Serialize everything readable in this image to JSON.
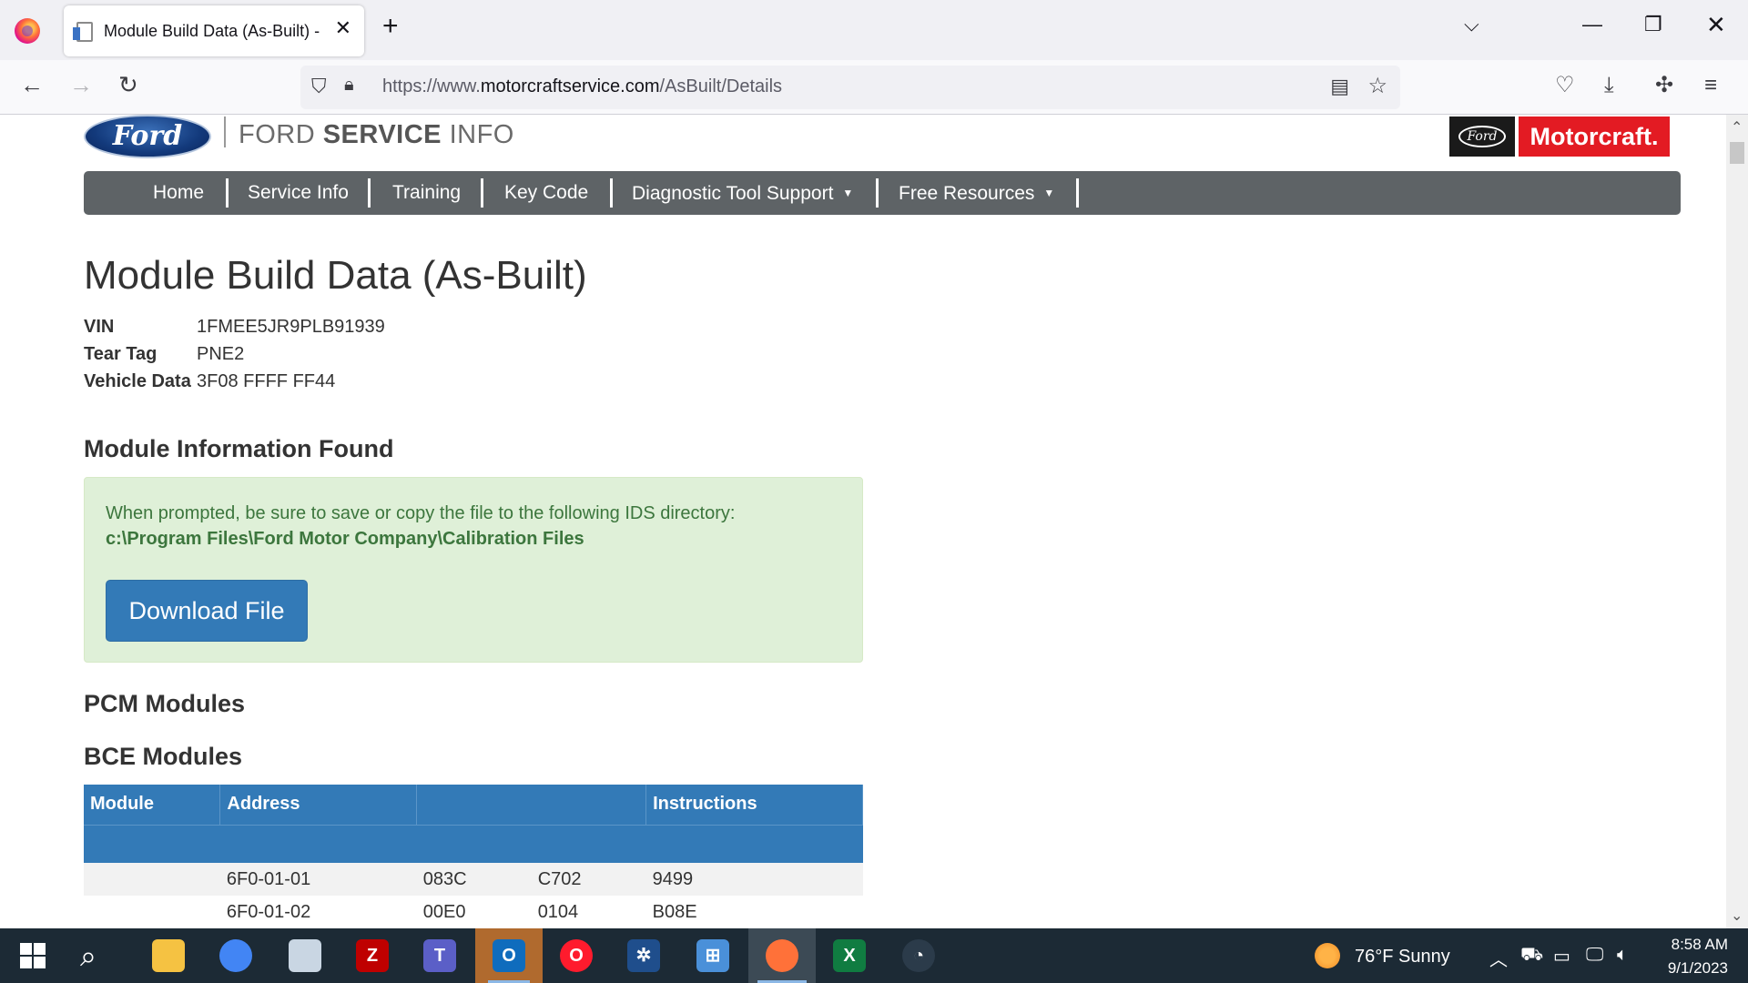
{
  "browser": {
    "tab_title": "Module Build Data (As-Built) - Ford",
    "url_prefix": "https://www.",
    "url_host": "motorcraftservice.com",
    "url_path": "/AsBuilt/Details"
  },
  "header": {
    "ford_oval_text": "Ford",
    "brand_light_1": "FORD ",
    "brand_bold": "SERVICE",
    "brand_light_2": " INFO",
    "motorcraft_ford_text": "Ford",
    "motorcraft_label": "Motorcraft."
  },
  "nav": {
    "items": [
      "Home",
      "Service Info",
      "Training",
      "Key Code",
      "Diagnostic Tool Support",
      "Free Resources"
    ]
  },
  "page": {
    "title": "Module Build Data (As-Built)",
    "vehicle_info": [
      {
        "label": "VIN",
        "value": "1FMEE5JR9PLB91939"
      },
      {
        "label": "Tear Tag",
        "value": "PNE2"
      },
      {
        "label": "Vehicle Data",
        "value": "3F08 FFFF FF44"
      }
    ],
    "module_info_heading": "Module Information Found",
    "alert_text": "When prompted, be sure to save or copy the file to the following IDS directory:",
    "alert_path": "c:\\Program Files\\Ford Motor Company\\Calibration Files",
    "download_label": "Download File",
    "pcm_heading": "PCM Modules",
    "bce_heading": "BCE Modules",
    "table": {
      "headers": [
        "Module",
        "Address",
        "",
        "Instructions"
      ],
      "rows": [
        [
          "",
          "6F0-01-01",
          "083C",
          "C702",
          "9499"
        ],
        [
          "",
          "6F0-01-02",
          "00E0",
          "0104",
          "B08E"
        ]
      ]
    }
  },
  "taskbar": {
    "weather": "76°F  Sunny",
    "time": "8:58 AM",
    "date": "9/1/2023",
    "apps": [
      {
        "name": "file-explorer-icon",
        "label": "",
        "color": "#f5c242"
      },
      {
        "name": "chrome-icon",
        "label": "",
        "color": "#4285f4"
      },
      {
        "name": "paint-icon",
        "label": "",
        "color": "#c9d6e3"
      },
      {
        "name": "filezilla-icon",
        "label": "Z",
        "color": "#bf0000"
      },
      {
        "name": "teams-icon",
        "label": "T",
        "color": "#5b5fc7"
      },
      {
        "name": "outlook-icon",
        "label": "O",
        "color": "#0f6cbd"
      },
      {
        "name": "opera-icon",
        "label": "O",
        "color": "#ff1b2d"
      },
      {
        "name": "ids-icon",
        "label": "✲",
        "color": "#1f4e8c"
      },
      {
        "name": "network-icon",
        "label": "⊞",
        "color": "#4a90d9"
      },
      {
        "name": "firefox-icon",
        "label": "",
        "color": "#ff7139"
      },
      {
        "name": "excel-icon",
        "label": "X",
        "color": "#107c41"
      },
      {
        "name": "clock-app-icon",
        "label": "◔",
        "color": "#2b3b4a"
      }
    ]
  }
}
